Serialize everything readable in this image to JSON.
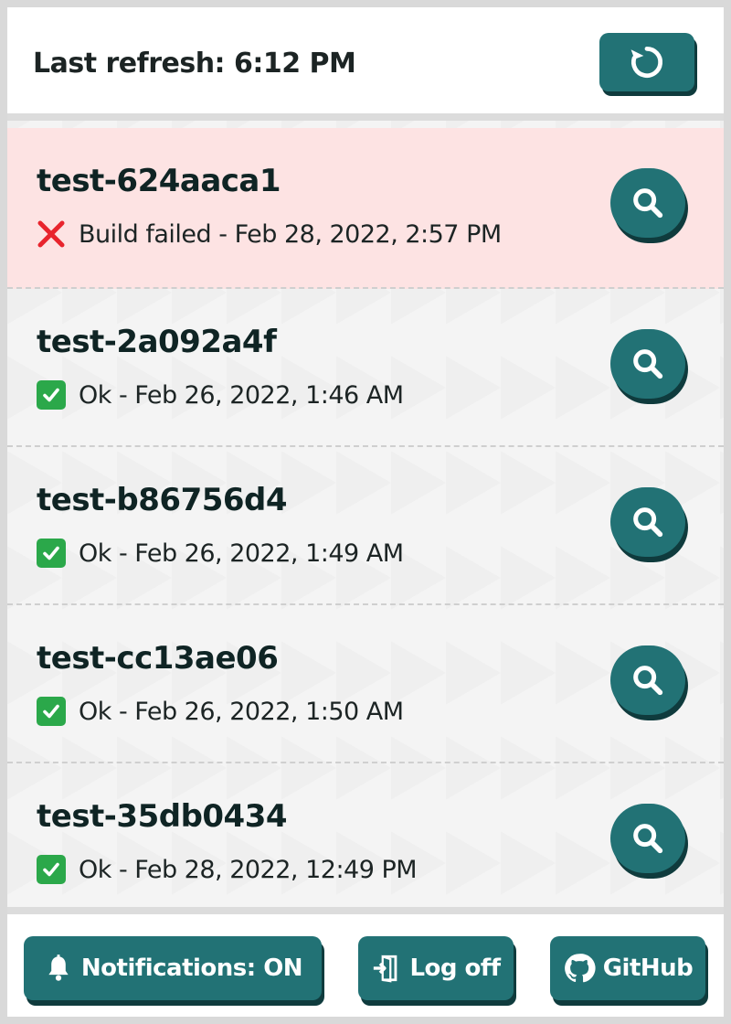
{
  "header": {
    "refresh_text": "Last refresh: 6:12 PM",
    "refresh_icon": "refresh-icon"
  },
  "tests": [
    {
      "name": "test-624aaca1",
      "status": "Build failed - Feb 28, 2022, 2:57 PM",
      "state": "failed"
    },
    {
      "name": "test-2a092a4f",
      "status": "Ok - Feb 26, 2022, 1:46 AM",
      "state": "ok"
    },
    {
      "name": "test-b86756d4",
      "status": "Ok - Feb 26, 2022, 1:49 AM",
      "state": "ok"
    },
    {
      "name": "test-cc13ae06",
      "status": "Ok - Feb 26, 2022, 1:50 AM",
      "state": "ok"
    },
    {
      "name": "test-35db0434",
      "status": "Ok - Feb 28, 2022, 12:49 PM",
      "state": "ok"
    }
  ],
  "footer": {
    "notifications_label": "Notifications: ON",
    "logoff_label": "Log off",
    "github_label": "GitHub"
  },
  "colors": {
    "accent": "#227275",
    "accent_shadow": "#0f3b3d",
    "failed_bg": "#fde3e3",
    "fail_x": "#e8242d",
    "ok_green": "#2ba84a"
  }
}
